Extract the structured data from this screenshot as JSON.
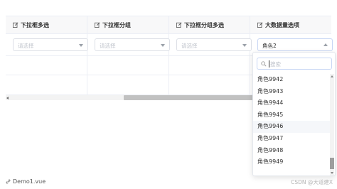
{
  "table": {
    "headers": [
      {
        "label": "下拉框多选",
        "icon": "edit-icon"
      },
      {
        "label": "下拉框分组",
        "icon": "edit-icon"
      },
      {
        "label": "下拉框分组多选",
        "icon": "edit-icon"
      },
      {
        "label": "大数据量选项",
        "icon": "edit-icon"
      }
    ],
    "selects": [
      {
        "placeholder": "请选择",
        "value": ""
      },
      {
        "placeholder": "请选择",
        "value": ""
      },
      {
        "placeholder": "请选择",
        "value": ""
      },
      {
        "placeholder": "",
        "value": "角色2"
      }
    ]
  },
  "dropdown": {
    "search_placeholder": "搜索",
    "items": [
      "角色9942",
      "角色9943",
      "角色9944",
      "角色9945",
      "角色9946",
      "角色9947",
      "角色9948",
      "角色9949"
    ],
    "hovered_item": "角色9946"
  },
  "footer": {
    "file_link": "Demo1.vue",
    "watermark": "CSDN @大道建X"
  },
  "colors": {
    "border": "#ebeef5",
    "header_bg": "#f8f8f9",
    "placeholder": "#c0c4cc",
    "hover_bg": "#f5f7fa",
    "focus_border": "#c7d6f4"
  }
}
